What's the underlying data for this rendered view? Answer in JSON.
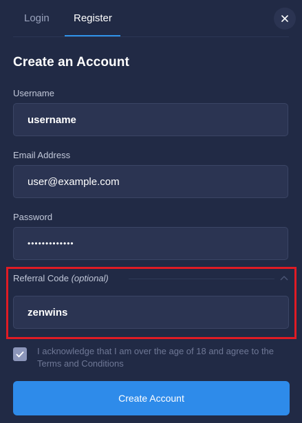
{
  "tabs": {
    "login": "Login",
    "register": "Register",
    "active": "Register"
  },
  "form": {
    "title": "Create an Account",
    "username": {
      "label": "Username",
      "value": "username"
    },
    "email": {
      "label": "Email Address",
      "value": "user@example.com"
    },
    "password": {
      "label": "Password",
      "value": "•••••••••••••"
    },
    "referral": {
      "label": "Referral Code",
      "label_optional": "(optional)",
      "value": "zenwins"
    },
    "acknowledge": {
      "checked": true,
      "text": "I acknowledge that I am over the age of 18 and agree to the Terms and Conditions"
    },
    "submit_label": "Create Account"
  },
  "icons": {
    "close": "close-icon",
    "chevron": "chevron-up-icon",
    "check": "check-icon"
  },
  "colors": {
    "background": "#212a45",
    "input_bg": "#2b3452",
    "accent": "#2e8bea",
    "highlight": "#e01b24"
  }
}
